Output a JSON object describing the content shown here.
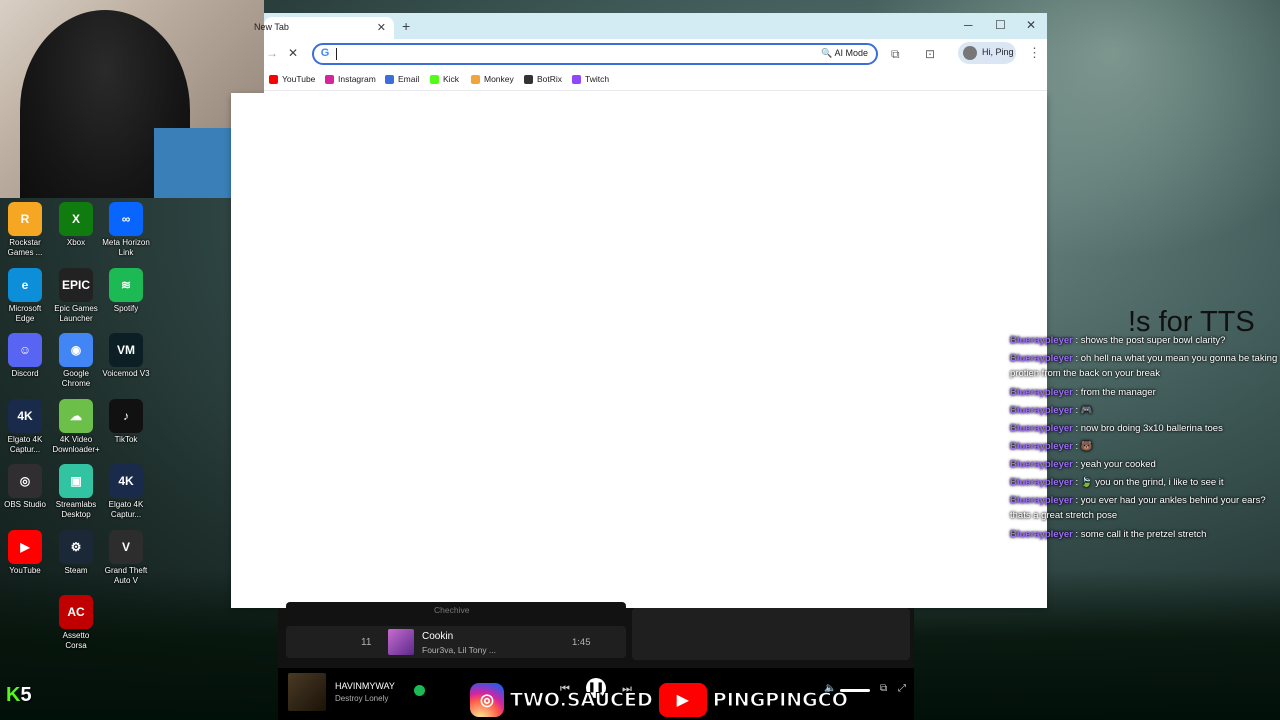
{
  "browser": {
    "tab_title": "New Tab",
    "search_placeholder": "",
    "ai_mode": "AI Mode",
    "profile_label": "Hi, Ping",
    "bookmarks": [
      {
        "label": "YouTube",
        "color": "#ff0000"
      },
      {
        "label": "Instagram",
        "color": "#d6249f"
      },
      {
        "label": "Email",
        "color": "#3b6ed8"
      },
      {
        "label": "Kick",
        "color": "#53fc18"
      },
      {
        "label": "Monkey",
        "color": "#f2a33a"
      },
      {
        "label": "BotRix",
        "color": "#333333"
      },
      {
        "label": "Twitch",
        "color": "#9146ff"
      }
    ]
  },
  "desktop_icons": [
    {
      "label": "Rockstar Games ...",
      "color": "#f5a623",
      "glyph": "R"
    },
    {
      "label": "Xbox",
      "color": "#107c10",
      "glyph": "X"
    },
    {
      "label": "Meta Horizon Link",
      "color": "#0866ff",
      "glyph": "∞"
    },
    {
      "label": "Microsoft Edge",
      "color": "#0c8ed9",
      "glyph": "e"
    },
    {
      "label": "Epic Games Launcher",
      "color": "#222222",
      "glyph": "EPIC"
    },
    {
      "label": "Spotify",
      "color": "#1db954",
      "glyph": "≋"
    },
    {
      "label": "Discord",
      "color": "#5865f2",
      "glyph": "☺"
    },
    {
      "label": "Google Chrome",
      "color": "#4285f4",
      "glyph": "◉"
    },
    {
      "label": "Voicemod V3",
      "color": "#0b1f24",
      "glyph": "VM"
    },
    {
      "label": "Elgato 4K Captur...",
      "color": "#1a2a4a",
      "glyph": "4K"
    },
    {
      "label": "4K Video Downloader+",
      "color": "#6cc04a",
      "glyph": "☁"
    },
    {
      "label": "TikTok",
      "color": "#111111",
      "glyph": "♪"
    },
    {
      "label": "OBS Studio",
      "color": "#302e31",
      "glyph": "◎"
    },
    {
      "label": "Streamlabs Desktop",
      "color": "#31c3a2",
      "glyph": "▣"
    },
    {
      "label": "Elgato 4K Captur...",
      "color": "#1a2a4a",
      "glyph": "4K"
    },
    {
      "label": "YouTube",
      "color": "#ff0000",
      "glyph": "▶"
    },
    {
      "label": "Steam",
      "color": "#1b2838",
      "glyph": "⚙"
    },
    {
      "label": "Grand Theft Auto V",
      "color": "#2d2d2d",
      "glyph": "V"
    },
    {
      "label": "Assetto Corsa",
      "color": "#c00000",
      "glyph": "AC"
    }
  ],
  "tts_label": "!s for TTS",
  "chat": [
    {
      "user": "Blueraypleyer",
      "msg": "shows the post super bowl clarity?"
    },
    {
      "user": "Blueraypleyer",
      "msg": "oh hell na what you mean you gonna be taking protien from the back on your break"
    },
    {
      "user": "Blueraypleyer",
      "msg": "from the manager"
    },
    {
      "user": "Blueraypleyer",
      "msg": "🎮"
    },
    {
      "user": "Blueraypleyer",
      "msg": "now bro doing 3x10 ballerina toes"
    },
    {
      "user": "Blueraypleyer",
      "msg": "🐻"
    },
    {
      "user": "Blueraypleyer",
      "msg": "yeah your cooked"
    },
    {
      "user": "Blueraypleyer",
      "msg": "🍃  you on the grind, i like to see it"
    },
    {
      "user": "Blueraypleyer",
      "msg": "you ever had your ankles behind your ears? thats a great stretch pose"
    },
    {
      "user": "Blueraypleyer",
      "msg": "some call it the pretzel stretch"
    }
  ],
  "spotify": {
    "prev_artist": "Chechive",
    "track_number": "11",
    "track_title": "Cookin",
    "track_artists": "Four3va, Lil Tony ...",
    "track_duration": "1:45",
    "now_playing_title": "HAVINMYWAY",
    "now_playing_artist": "Destroy Lonely"
  },
  "banner": {
    "instagram_handle": "TWO.SAUCED",
    "youtube_handle": "PINGPINGCO"
  },
  "corner_counter": "5"
}
